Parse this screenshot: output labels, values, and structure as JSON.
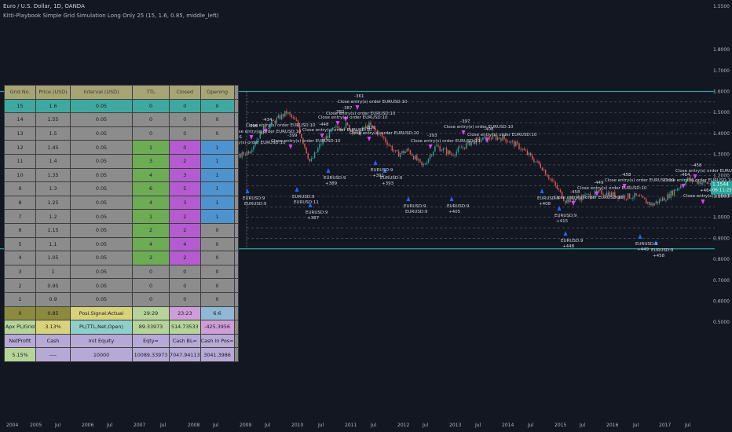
{
  "header": {
    "title": "Euro / U.S. Dollar, 1D, OANDA",
    "indicator": "Kitti-Playbook Simple Grid Simulation Long Only 25 (15, 1.6, 0.85, middle_left)"
  },
  "colors": {
    "background": "#131722",
    "grid_line": "#5d606b",
    "top_line": "#26a69a",
    "bottom_line": "#26a69a",
    "candle_up": "#26a69a",
    "candle_down": "#ef5350",
    "buy_arrow": "#2962ff",
    "sell_arrow": "#e040fb",
    "price_badge": "#26a69a"
  },
  "price_axis": {
    "labels": [
      "1.5500",
      "1.8000",
      "1.7000",
      "1.6000",
      "1.5000",
      "1.4000",
      "1.3000",
      "1.2000",
      "1.1000",
      "1.0000",
      "0.9000",
      "0.8000",
      "0.7000",
      "0.6000",
      "0.5000"
    ],
    "current_price": "1.1544",
    "countdown": "06:11:25"
  },
  "time_axis": {
    "labels": [
      "2004",
      "2005",
      "Jul",
      "2006",
      "Jul",
      "2007",
      "Jul",
      "2008",
      "Jul",
      "2009",
      "Jul",
      "2010",
      "Jul",
      "2011",
      "Jul",
      "2012",
      "Jul",
      "2013",
      "Jul",
      "2014",
      "Jul",
      "2015",
      "Jul",
      "2016",
      "Jul",
      "2017",
      "Jul"
    ]
  },
  "table": {
    "headers": [
      "Grid No.",
      "Price (USD)",
      "Interval (USD)",
      "TTL",
      "Closed",
      "Opening"
    ],
    "rows": [
      {
        "cells": [
          "15",
          "1.6",
          "0.05",
          "0",
          "0",
          "0"
        ],
        "style": "teal"
      },
      {
        "cells": [
          "14",
          "1.55",
          "0.05",
          "0",
          "0",
          "0"
        ],
        "style": "gray"
      },
      {
        "cells": [
          "13",
          "1.5",
          "0.05",
          "0",
          "0",
          "0"
        ],
        "style": "gray"
      },
      {
        "cells": [
          "12",
          "1.45",
          "0.05",
          "1",
          "0",
          "1"
        ],
        "style": "mix"
      },
      {
        "cells": [
          "11",
          "1.4",
          "0.05",
          "3",
          "2",
          "1"
        ],
        "style": "mix"
      },
      {
        "cells": [
          "10",
          "1.35",
          "0.05",
          "4",
          "3",
          "1"
        ],
        "style": "mix"
      },
      {
        "cells": [
          "9",
          "1.3",
          "0.05",
          "6",
          "5",
          "1"
        ],
        "style": "mix"
      },
      {
        "cells": [
          "8",
          "1.25",
          "0.05",
          "4",
          "3",
          "1"
        ],
        "style": "mix"
      },
      {
        "cells": [
          "7",
          "1.2",
          "0.05",
          "1",
          "2",
          "1"
        ],
        "style": "mix"
      },
      {
        "cells": [
          "6",
          "1.15",
          "0.05",
          "2",
          "2",
          "0"
        ],
        "style": "mix2"
      },
      {
        "cells": [
          "5",
          "1.1",
          "0.05",
          "4",
          "4",
          "0"
        ],
        "style": "mix2"
      },
      {
        "cells": [
          "4",
          "1.05",
          "0.05",
          "2",
          "2",
          "0"
        ],
        "style": "mix2"
      },
      {
        "cells": [
          "3",
          "1",
          "0.05",
          "0",
          "0",
          "0"
        ],
        "style": "gray"
      },
      {
        "cells": [
          "2",
          "0.95",
          "0.05",
          "0",
          "0",
          "0"
        ],
        "style": "gray"
      },
      {
        "cells": [
          "1",
          "0.9",
          "0.05",
          "0",
          "0",
          "0"
        ],
        "style": "gray"
      },
      {
        "cells": [
          "0",
          "0.85",
          "Posi.Signal:Actual",
          "29:29",
          "23:23",
          "6:6"
        ],
        "style": "olive"
      }
    ],
    "summary": [
      {
        "cells": [
          "Apx PL/Grid",
          "3.13%",
          "PL(TTL,Net,Open)",
          "89.33973",
          "514.73533",
          "-425.3956"
        ]
      },
      {
        "cells": [
          "NetProfit",
          "Cash",
          "Init Equity",
          "Eqty=",
          "Cash BL=",
          "Cash in Pos="
        ]
      },
      {
        "cells": [
          "5.15%",
          "----",
          "10000",
          "10089.33973",
          "7047.94113",
          "3041.3986"
        ]
      }
    ]
  },
  "annotations": {
    "close_label": "Close entry(s) order EURUSD:",
    "texts": [
      "-358",
      "-361",
      "-370",
      "-372",
      "-380",
      "-382",
      "-385",
      "-387",
      "-389",
      "-390",
      "-391",
      "-393",
      "-396",
      "-397",
      "-399",
      "-401",
      "-405",
      "-408",
      "-415",
      "-434",
      "-448",
      "-449",
      "-458",
      "-464",
      "EURUSD:9",
      "EURUSD:8",
      "EURUSD:7",
      "EURUSD:10",
      "EURUSD:11",
      "EURUSD:12",
      "EURUSD:6",
      "EURUSD:5",
      "EURUSD:4",
      "+358",
      "+370",
      "+376",
      "+377",
      "+380",
      "+383",
      "+385",
      "+387",
      "+389",
      "+391",
      "+393",
      "+396",
      "+405",
      "+408",
      "+415",
      "+448",
      "+449",
      "+458",
      "+464"
    ]
  }
}
